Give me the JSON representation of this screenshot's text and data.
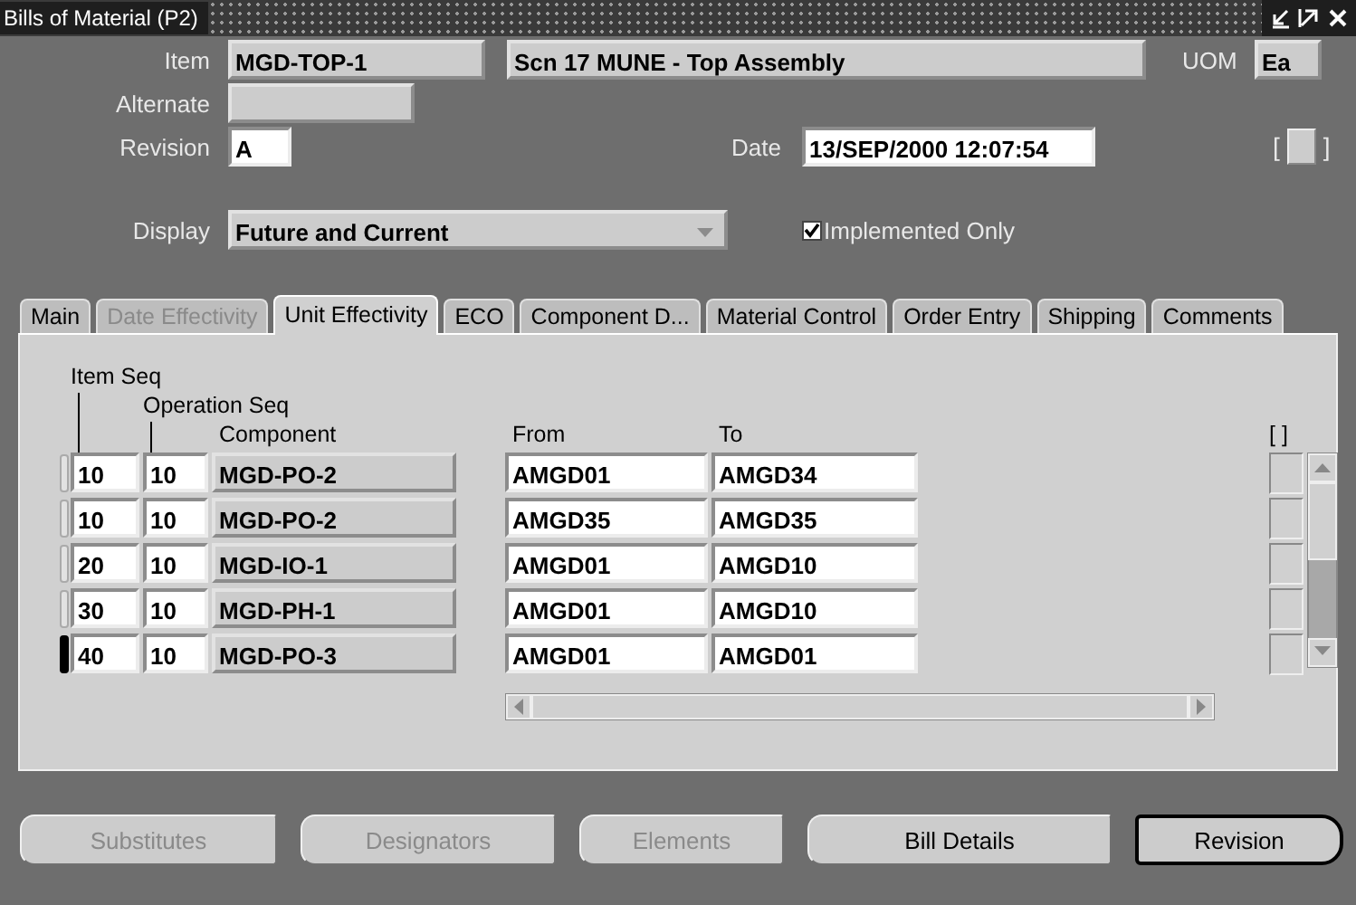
{
  "window": {
    "title": "Bills of Material (P2)"
  },
  "header": {
    "item": {
      "label": "Item",
      "value": "MGD-TOP-1"
    },
    "description": {
      "value": "Scn 17 MUNE - Top Assembly"
    },
    "uom": {
      "label": "UOM",
      "value": "Ea"
    },
    "alternate": {
      "label": "Alternate"
    },
    "revision": {
      "label": "Revision",
      "value": "A"
    },
    "date": {
      "label": "Date",
      "value": "13/SEP/2000 12:07:54"
    },
    "flex_field": {
      "open": "[",
      "close": "]"
    },
    "display": {
      "label": "Display",
      "value": "Future and Current"
    },
    "implemented_only": {
      "label": "Implemented Only",
      "checked": true
    }
  },
  "tabs": [
    {
      "label": "Main",
      "selected": false,
      "disabled": false
    },
    {
      "label": "Date Effectivity",
      "selected": false,
      "disabled": true
    },
    {
      "label": "Unit Effectivity",
      "selected": true,
      "disabled": false
    },
    {
      "label": "ECO",
      "selected": false,
      "disabled": false
    },
    {
      "label": "Component D...",
      "selected": false,
      "disabled": false
    },
    {
      "label": "Material Control",
      "selected": false,
      "disabled": false
    },
    {
      "label": "Order Entry",
      "selected": false,
      "disabled": false
    },
    {
      "label": "Shipping",
      "selected": false,
      "disabled": false
    },
    {
      "label": "Comments",
      "selected": false,
      "disabled": false
    }
  ],
  "table": {
    "headings": {
      "item_seq": "Item Seq",
      "operation_seq": "Operation Seq",
      "component": "Component",
      "from": "From",
      "to": "To",
      "flex": "[ ]"
    },
    "rows": [
      {
        "item_seq": "10",
        "operation_seq": "10",
        "component": "MGD-PO-2",
        "from": "AMGD01",
        "to": "AMGD34",
        "selected": false
      },
      {
        "item_seq": "10",
        "operation_seq": "10",
        "component": "MGD-PO-2",
        "from": "AMGD35",
        "to": "AMGD35",
        "selected": false
      },
      {
        "item_seq": "20",
        "operation_seq": "10",
        "component": "MGD-IO-1",
        "from": "AMGD01",
        "to": "AMGD10",
        "selected": false
      },
      {
        "item_seq": "30",
        "operation_seq": "10",
        "component": "MGD-PH-1",
        "from": "AMGD01",
        "to": "AMGD10",
        "selected": false
      },
      {
        "item_seq": "40",
        "operation_seq": "10",
        "component": "MGD-PO-3",
        "from": "AMGD01",
        "to": "AMGD01",
        "selected": true
      }
    ]
  },
  "buttons": [
    {
      "label": "Substitutes",
      "disabled": true,
      "default": false
    },
    {
      "label": "Designators",
      "disabled": true,
      "default": false
    },
    {
      "label": "Elements",
      "disabled": true,
      "default": false
    },
    {
      "label": "Bill Details",
      "disabled": false,
      "default": false
    },
    {
      "label": "Revision",
      "disabled": false,
      "default": true
    }
  ]
}
